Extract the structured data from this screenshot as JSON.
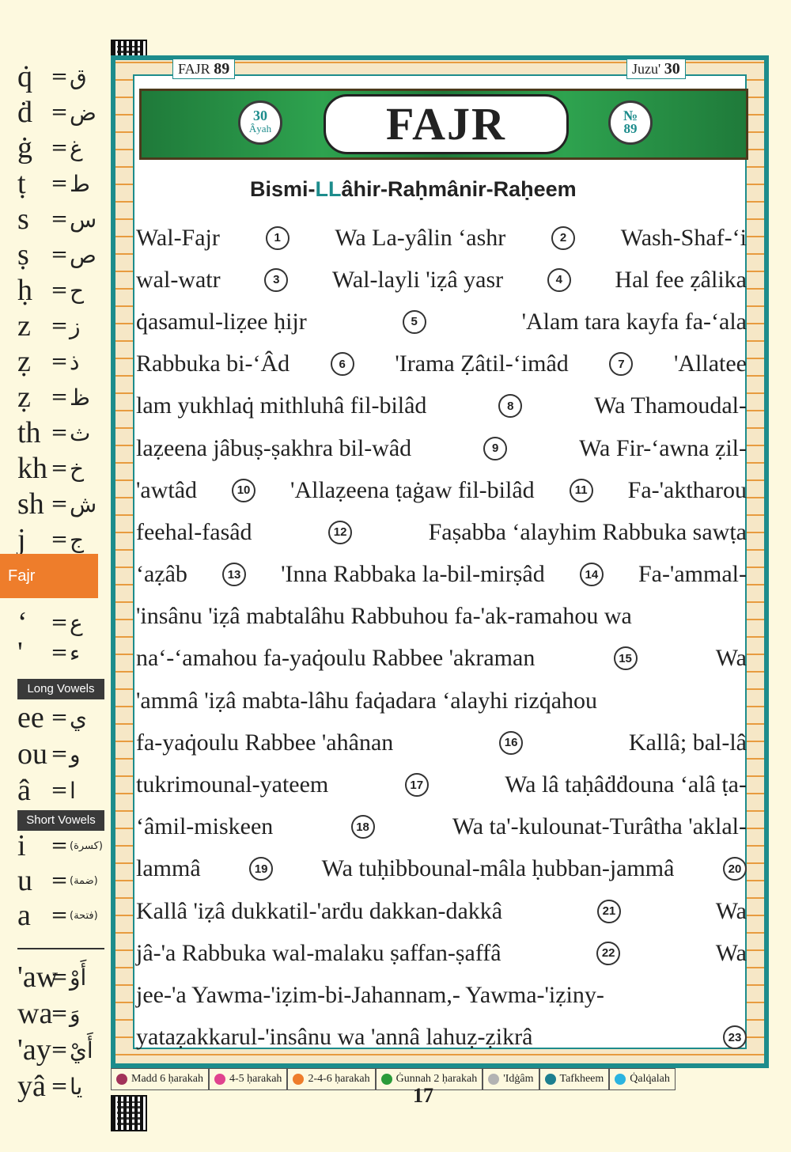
{
  "header": {
    "surah_label": "FAJR",
    "surah_number": "89",
    "juz_label": "Juzu'",
    "juz_number": "30",
    "title": "FAJR",
    "ayah_count": "30",
    "ayah_word": "Âyah",
    "number_sign": "№",
    "number_value": "89"
  },
  "key": {
    "rows_top": [
      {
        "lat": "q̇",
        "ar": "ق"
      },
      {
        "lat": "ḋ",
        "ar": "ض"
      },
      {
        "lat": "ġ",
        "ar": "غ"
      },
      {
        "lat": "ṭ",
        "ar": "ط"
      },
      {
        "lat": "s",
        "ar": "س"
      },
      {
        "lat": "ṣ",
        "ar": "ص"
      },
      {
        "lat": "ḥ",
        "ar": "ح"
      },
      {
        "lat": "z",
        "ar": "ز"
      },
      {
        "lat": "ẓ",
        "ar": "ذ"
      },
      {
        "lat": "ẓ",
        "ar": "ظ"
      },
      {
        "lat": "th",
        "ar": "ث"
      },
      {
        "lat": "kh",
        "ar": "خ"
      },
      {
        "lat": "sh",
        "ar": "ش"
      },
      {
        "lat": "j",
        "ar": "ج"
      }
    ],
    "tab_label": "Fajr",
    "rows_mid": [
      {
        "lat": "‘",
        "ar": "ع"
      },
      {
        "lat": "'",
        "ar": "ء"
      }
    ],
    "long_vowels_label": "Long Vowels",
    "long_vowels": [
      {
        "lat": "ee",
        "ar": "ي"
      },
      {
        "lat": "ou",
        "ar": "و"
      },
      {
        "lat": "â",
        "ar": "ا"
      }
    ],
    "short_vowels_label": "Short Vowels",
    "short_vowels": [
      {
        "lat": "i",
        "ar": "(كسرة)"
      },
      {
        "lat": "u",
        "ar": "(ضمة)"
      },
      {
        "lat": "a",
        "ar": "(فتحة)"
      }
    ],
    "diphthongs": [
      {
        "lat": "'aw",
        "ar": "أَوْ"
      },
      {
        "lat": "wa",
        "ar": "وَ"
      },
      {
        "lat": "'ay",
        "ar": "أَيْ"
      },
      {
        "lat": "yâ",
        "ar": "يا"
      }
    ]
  },
  "bismillah": {
    "a": "Bismi-",
    "b": "LL",
    "c": "âhir-",
    "d": "Raḥmânir-",
    "e": "Raḥeem"
  },
  "lines": [
    [
      "Wal-Fajr",
      "1",
      "Wa La-yâlin ‘ashr",
      "2",
      "Wash-Shaf-‘i"
    ],
    [
      "wal-watr",
      "3",
      "Wal-layli 'iẓâ yasr",
      "4",
      "Hal fee ẓâlika"
    ],
    [
      "q̇asamul-liẓee ḥijr",
      "5",
      "'Alam tara kayfa fa-‘ala"
    ],
    [
      "Rabbuka bi-‘Âd",
      "6",
      "'Irama Ẓâtil-‘imâd",
      "7",
      "'Allatee"
    ],
    [
      "lam yukhlaq̇ mithluhâ fil-bilâd",
      "8",
      "Wa Thamoudal-"
    ],
    [
      "laẓeena jâbuṣ-ṣakhra bil-wâd",
      "9",
      "Wa Fir-‘awna ẓil-"
    ],
    [
      "'awtâd",
      "10",
      "'Allaẓeena ṭaġaw fil-bilâd",
      "11",
      "Fa-'aktharou"
    ],
    [
      "feehal-fasâd",
      "12",
      "Faṣabba ‘alayhim Rabbuka sawṭa"
    ],
    [
      "‘aẓâb",
      "13",
      "'Inna Rabbaka la-bil-mirṣâd",
      "14",
      "Fa-'ammal-"
    ],
    [
      "'insânu 'iẓâ mabtalâhu Rabbuhou fa-'ak-ramahou wa"
    ],
    [
      "na‘-‘amahou fa-yaq̇oulu Rabbee 'akraman",
      "15",
      "Wa"
    ],
    [
      "'ammâ 'iẓâ mabta-lâhu faq̇adara ‘alayhi rizq̇ahou"
    ],
    [
      "fa-yaq̇oulu Rabbee 'ahânan",
      "16",
      "Kallâ; bal-lâ"
    ],
    [
      "tukrimounal-yateem",
      "17",
      "Wa lâ taḥâḋḋouna ‘alâ ṭa-"
    ],
    [
      "‘âmil-miskeen",
      "18",
      "Wa ta'-kulounat-Turâtha 'aklal-"
    ],
    [
      "lammâ",
      "19",
      "Wa tuḥibbounal-mâla ḥubban-jammâ",
      "20"
    ],
    [
      "Kallâ 'iẓâ dukkatil-'arḋu dakkan-dakkâ",
      "21",
      "Wa"
    ],
    [
      "jâ-'a Rabbuka wal-malaku ṣaffan-ṣaffâ",
      "22",
      "Wa"
    ],
    [
      "jee-'a Yawma-'iẓim-bi-Jahannam,- Yawma-'iẓiny-"
    ],
    [
      "yataẓakkarul-'insânu wa 'annâ lahuẓ-ẓikrâ",
      "23"
    ]
  ],
  "legend": [
    {
      "color": "#a2335a",
      "label": "Madd 6 ḥarakah"
    },
    {
      "color": "#e0438f",
      "label": "4-5 ḥarakah"
    },
    {
      "color": "#ee7d2b",
      "label": "2-4-6 ḥarakah"
    },
    {
      "color": "#2b9b3a",
      "label": "Ġunnah 2 ḥarakah"
    },
    {
      "color": "#b3b3b3",
      "label": "'Idġâm"
    },
    {
      "color": "#1d7f8f",
      "label": "Tafkheem"
    },
    {
      "color": "#2bb4e0",
      "label": "Q̇alq̇alah"
    }
  ],
  "page_number": "17"
}
